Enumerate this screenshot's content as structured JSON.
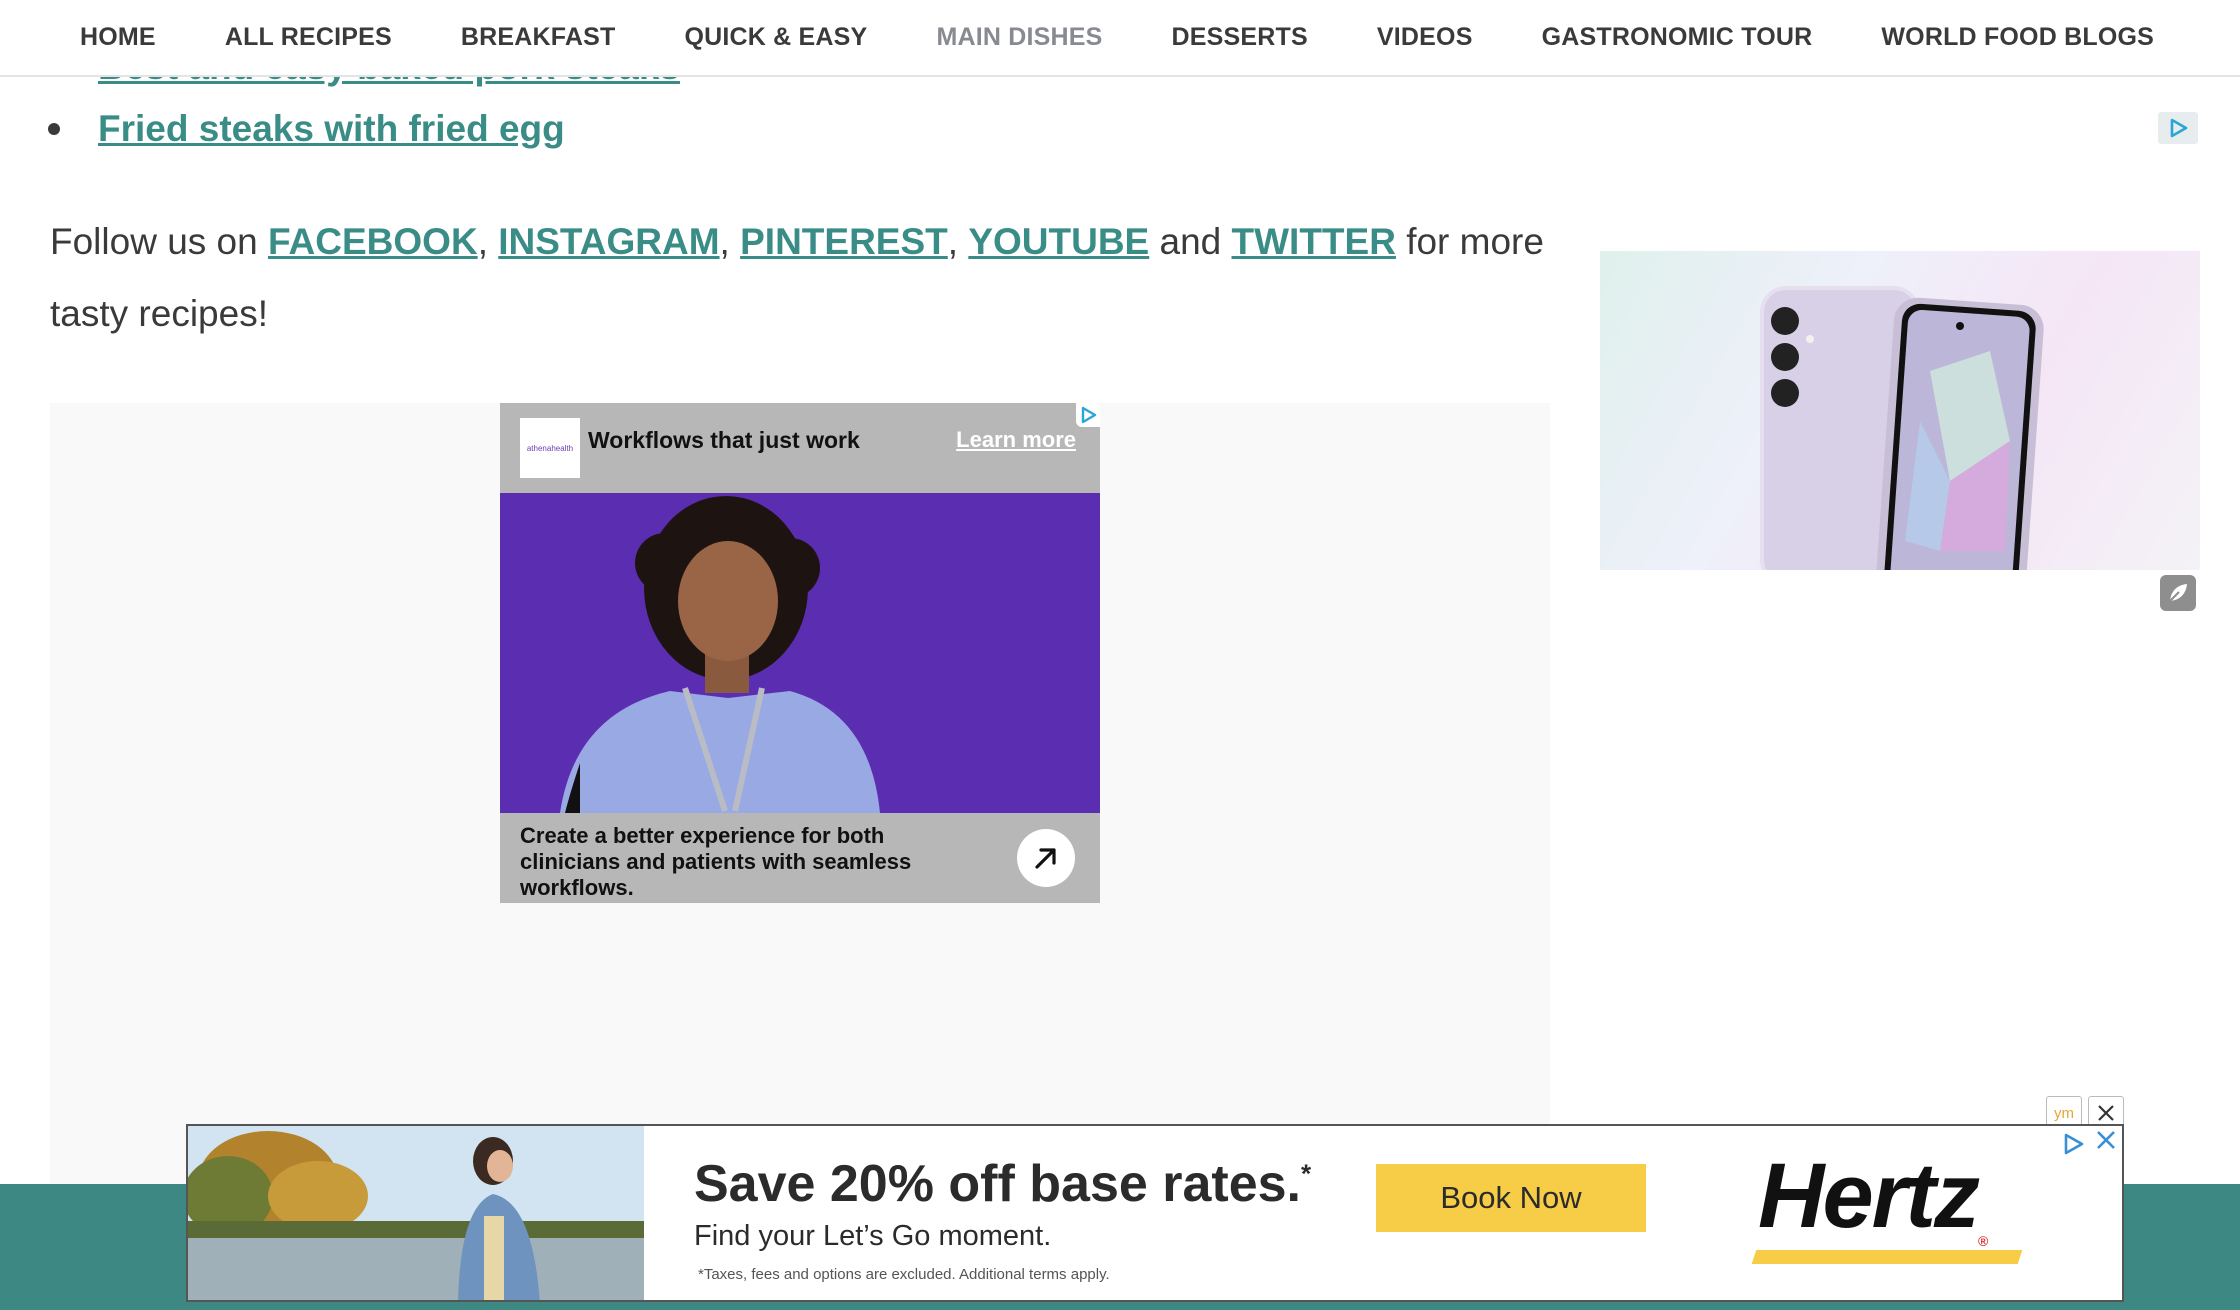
{
  "nav": {
    "items": [
      {
        "label": "HOME"
      },
      {
        "label": "ALL RECIPES"
      },
      {
        "label": "BREAKFAST"
      },
      {
        "label": "QUICK & EASY"
      },
      {
        "label": "MAIN DISHES"
      },
      {
        "label": "DESSERTS"
      },
      {
        "label": "VIDEOS"
      },
      {
        "label": "GASTRONOMIC TOUR"
      },
      {
        "label": "WORLD FOOD BLOGS"
      }
    ],
    "active": "MAIN DISHES"
  },
  "content": {
    "partial_link": "Best and easy baked pork steaks",
    "list_item": "Fried steaks with fried egg",
    "follow": {
      "prefix": "Follow us on ",
      "facebook": "FACEBOOK",
      "comma1": ", ",
      "instagram": "INSTAGRAM",
      "comma2": ", ",
      "pinterest": "PINTEREST",
      "comma3": ", ",
      "youtube": "YOUTUBE",
      "and": " and ",
      "twitter": "TWITTER",
      "suffix": " for more tasty recipes!"
    }
  },
  "inline_ad": {
    "logo_text": "athenahealth",
    "headline": "Workflows that just work",
    "learn_more": "Learn more",
    "description": "Create a better experience for both clinicians and patients with seamless workflows.",
    "icons": [
      "adchoices-icon",
      "arrow-up-right-icon"
    ]
  },
  "banner_ad": {
    "headline": "Save 20% off base rates.",
    "headline_mark": "*",
    "subline": "Find your Let’s Go moment.",
    "note": "*Taxes, fees and options are excluded. Additional terms apply.",
    "cta": "Book Now",
    "brand": "Hertz",
    "brand_mark": "®",
    "ym_badge": "ym",
    "colors": {
      "cta": "#f7cc46",
      "brand_bar": "#f7cc46"
    }
  },
  "colors": {
    "link": "#3a8c87",
    "footer": "#3d8883",
    "ad_purple": "#5b2db0"
  }
}
